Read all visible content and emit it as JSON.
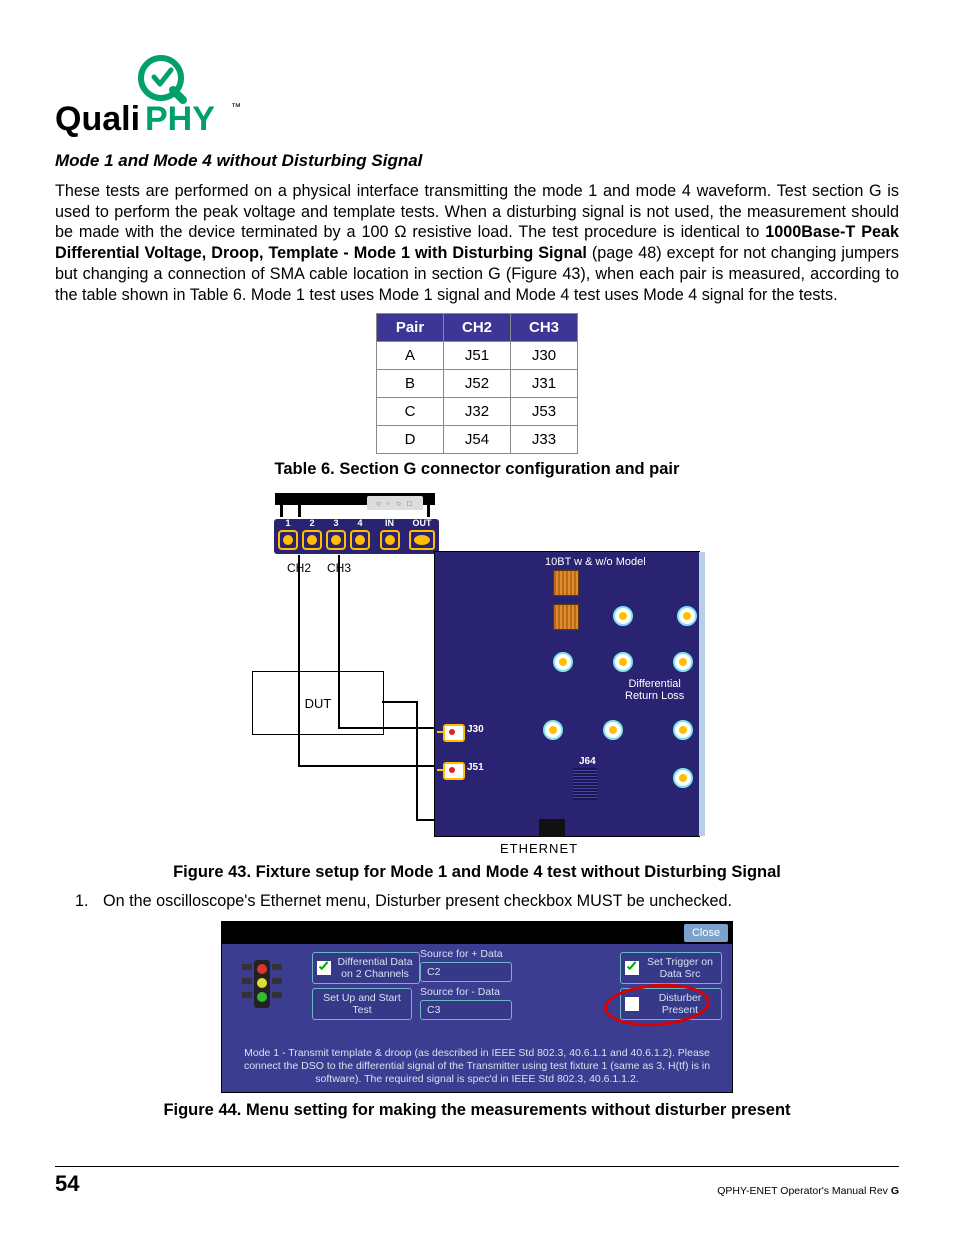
{
  "logo_text_1": "QualiPHY",
  "logo_tm": "™",
  "heading": "Mode 1 and Mode 4 without Disturbing Signal",
  "para_parts": {
    "p1a": "These tests are performed on a physical interface transmitting the mode 1 and mode 4 waveform. Test section G is used to perform the peak voltage and template tests. When a disturbing signal is not used, the measurement should be made with the device terminated by a 100 Ω resistive load. The test procedure is identical to ",
    "p1b": "1000Base-T Peak Differential Voltage, Droop, Template - Mode 1 with Disturbing Signal",
    "p1c": " (page 48) except for not changing jumpers but changing a connection of SMA cable location in section G (Figure 43), when each pair is measured, according to the table shown in Table 6. Mode 1 test uses Mode 1 signal and Mode 4 test uses Mode 4 signal for the tests."
  },
  "table": {
    "headers": [
      "Pair",
      "CH2",
      "CH3"
    ],
    "rows": [
      [
        "A",
        "J51",
        "J30"
      ],
      [
        "B",
        "J52",
        "J31"
      ],
      [
        "C",
        "J32",
        "J53"
      ],
      [
        "D",
        "J54",
        "J33"
      ]
    ]
  },
  "table_caption": "Table 6. Section G connector configuration and pair",
  "fig43": {
    "ch2": "CH2",
    "ch3": "CH3",
    "in": "IN",
    "out": "OUT",
    "nums": [
      "1",
      "2",
      "3",
      "4"
    ],
    "dut": "DUT",
    "label_10bt": "10BT w & w/o Model",
    "label_drl1": "Differential",
    "label_drl2": "Return Loss",
    "j30": "J30",
    "j51": "J51",
    "j64": "J64",
    "ethernet": "ETHERNET"
  },
  "fig43_caption": "Figure 43. Fixture setup for Mode 1 and Mode 4 test without Disturbing Signal",
  "step1": "On the oscilloscope's Ethernet menu, Disturber present checkbox MUST be unchecked.",
  "fig44": {
    "close": "Close",
    "diff_data": "Differential Data on 2 Channels",
    "setup": "Set Up and Start Test",
    "src_plus": "Source for + Data",
    "c2": "C2",
    "src_minus": "Source for - Data",
    "c3": "C3",
    "set_trig": "Set Trigger on Data Src",
    "dist_present": "Disturber Present",
    "msg": "Mode 1 - Transmit template & droop (as described in IEEE Std 802.3, 40.6.1.1 and 40.6.1.2). Please connect the DSO to the differential signal of the Transmitter using test fixture 1 (same as 3, H(tf) is in software). The required signal is spec'd in IEEE Std 802.3, 40.6.1.1.2."
  },
  "fig44_caption": "Figure 44. Menu setting for making the measurements without disturber present",
  "page_number": "54",
  "footer_right_a": "QPHY-ENET Operator's Manual Rev ",
  "footer_right_b": "G"
}
